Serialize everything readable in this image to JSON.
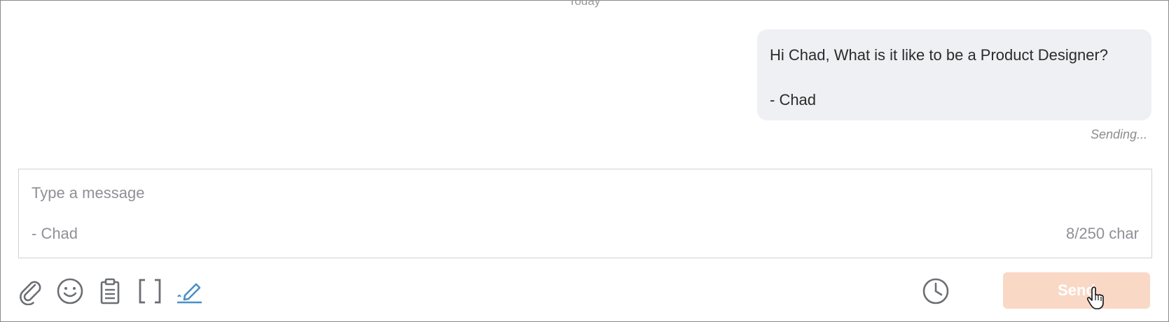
{
  "conversation": {
    "day_divider": "Today",
    "outgoing_message": {
      "lines": [
        "Hi Chad, What is it like to be a Product Designer?",
        "- Chad"
      ],
      "status": "Sending..."
    }
  },
  "composer": {
    "placeholder": "Type a message",
    "signature": "- Chad",
    "char_counter": "8/250 char"
  },
  "toolbar": {
    "icons": [
      "paperclip-icon",
      "emoji-icon",
      "clipboard-icon",
      "brackets-icon",
      "pen-signature-icon",
      "clock-icon"
    ],
    "send_label": "Send"
  },
  "colors": {
    "bubble_bg": "#eff0f3",
    "send_button_bg": "#fad8c6",
    "signature_icon_accent": "#4a90c7",
    "icon_gray": "#6b6e73"
  }
}
